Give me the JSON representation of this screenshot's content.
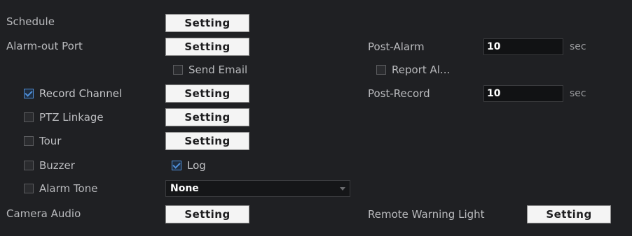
{
  "form": {
    "schedule": {
      "label": "Schedule",
      "button": "Setting"
    },
    "alarm_out_port": {
      "label": "Alarm-out Port",
      "button": "Setting"
    },
    "send_email": {
      "label": "Send Email",
      "checked": false
    },
    "record_channel": {
      "label": "Record Channel",
      "checked": true,
      "button": "Setting"
    },
    "ptz_linkage": {
      "label": "PTZ Linkage",
      "checked": false,
      "button": "Setting"
    },
    "tour": {
      "label": "Tour",
      "checked": false,
      "button": "Setting"
    },
    "buzzer": {
      "label": "Buzzer",
      "checked": false
    },
    "log": {
      "label": "Log",
      "checked": true
    },
    "alarm_tone": {
      "label": "Alarm Tone",
      "checked": false,
      "value": "None"
    },
    "camera_audio": {
      "label": "Camera Audio",
      "button": "Setting"
    },
    "post_alarm": {
      "label": "Post-Alarm",
      "value": "10",
      "unit": "sec"
    },
    "report_alarm": {
      "label": "Report Al...",
      "checked": false
    },
    "post_record": {
      "label": "Post-Record",
      "value": "10",
      "unit": "sec"
    },
    "remote_warning_light": {
      "label": "Remote Warning Light",
      "button": "Setting"
    }
  },
  "colors": {
    "accent": "#4f8fd8",
    "background": "#1f2023",
    "button_bg": "#f4f4f4"
  }
}
